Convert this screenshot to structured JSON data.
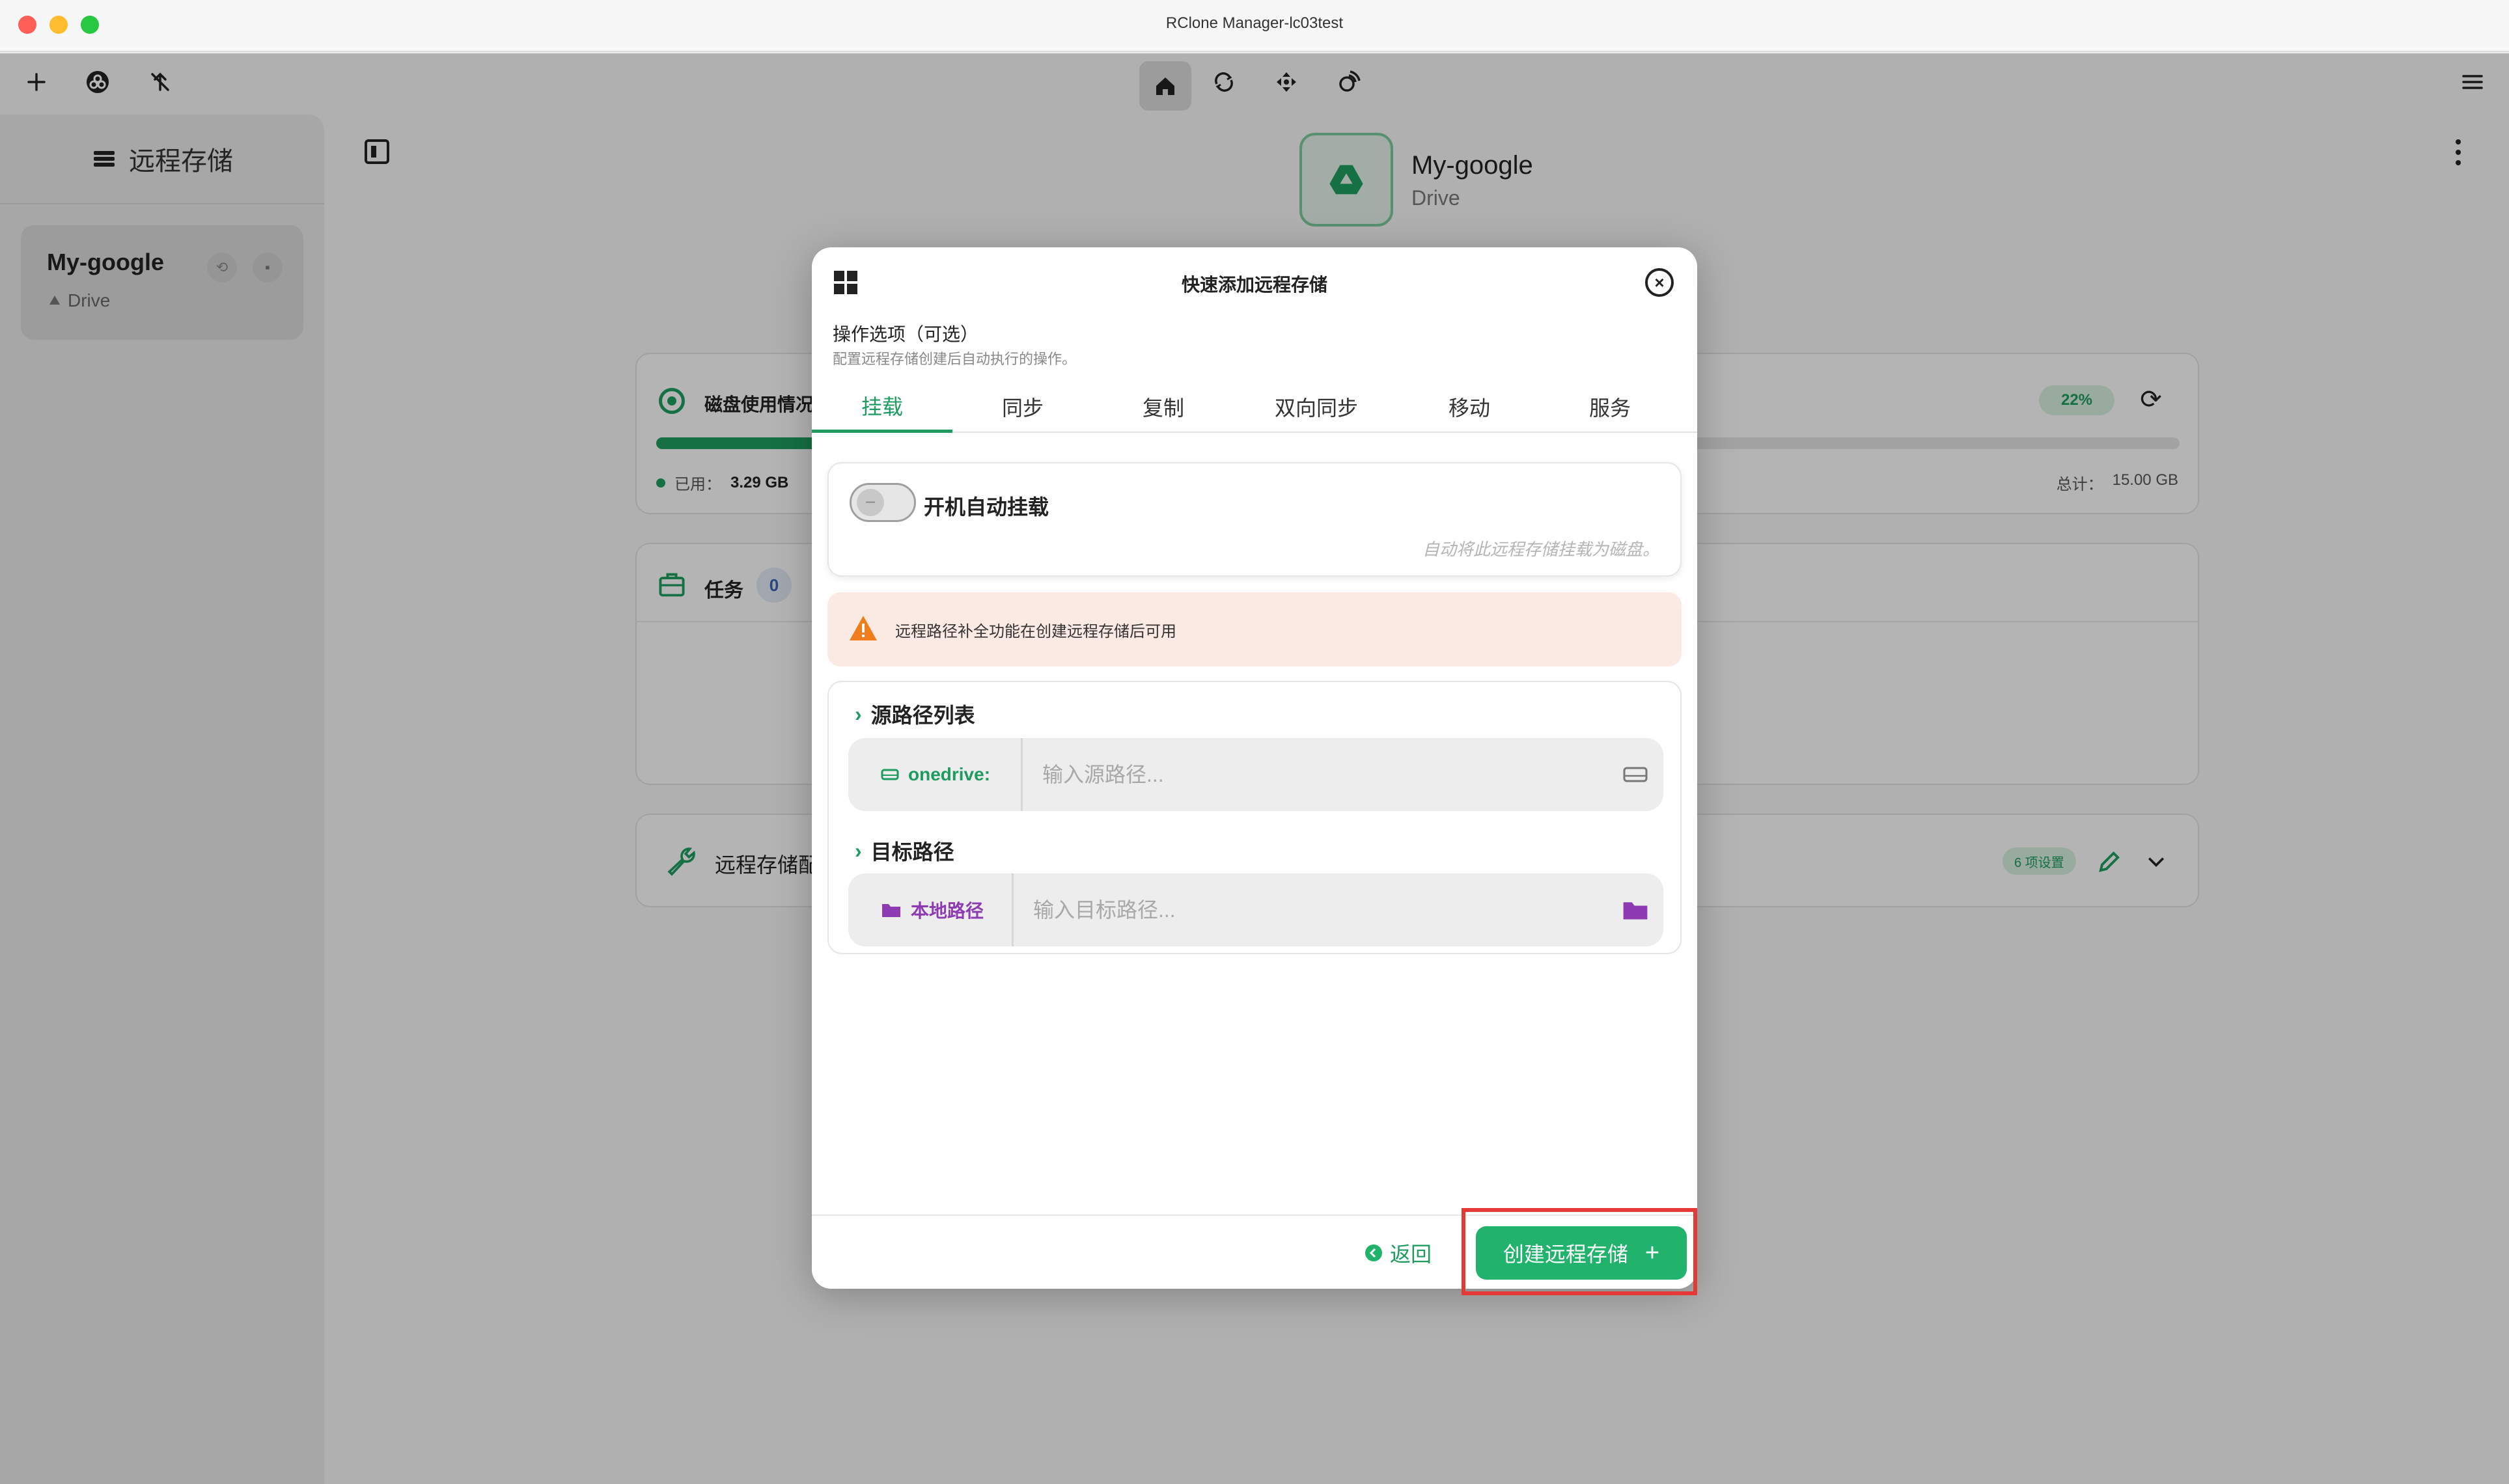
{
  "window": {
    "title": "RClone Manager-lc03test"
  },
  "toolbar": {
    "left_icons": [
      "plus-icon",
      "rclone-logo-icon",
      "no-network-icon"
    ],
    "center_icons": [
      "home-icon",
      "sync-icon",
      "move-icon",
      "serve-icon"
    ],
    "right_icon": "menu-icon"
  },
  "sidebar": {
    "title": "远程存储",
    "remotes": [
      {
        "name": "My-google",
        "type": "Drive"
      }
    ]
  },
  "main": {
    "remote_name": "My-google",
    "remote_type": "Drive",
    "disk": {
      "title": "磁盘使用情况",
      "used_label": "已用：",
      "used": "3.29 GB",
      "total_label": "总计：",
      "total": "15.00 GB",
      "percent_text": "22%",
      "percent": 0.22
    },
    "tasks": {
      "title": "任务",
      "count": "0"
    },
    "config": {
      "title": "远程存储配",
      "badge": "6 项设置"
    }
  },
  "modal": {
    "title": "快速添加远程存储",
    "options_title": "操作选项（可选）",
    "options_subtitle": "配置远程存储创建后自动执行的操作。",
    "tabs": [
      "挂载",
      "同步",
      "复制",
      "双向同步",
      "移动",
      "服务"
    ],
    "active_tab": 0,
    "mount": {
      "toggle_label": "开机自动挂载",
      "hint": "自动将此远程存储挂载为磁盘。",
      "enabled": false
    },
    "warning": "远程路径补全功能在创建远程存储后可用",
    "source": {
      "section_label": "源路径列表",
      "prefix": "onedrive:",
      "placeholder": "输入源路径..."
    },
    "target": {
      "section_label": "目标路径",
      "prefix": "本地路径",
      "placeholder": "输入目标路径..."
    },
    "footer": {
      "back_label": "返回",
      "create_label": "创建远程存储",
      "create_icon": "+"
    }
  },
  "colors": {
    "accent": "#1e9b5f",
    "button": "#21b26b",
    "warning_bg": "#fbeae3",
    "warning_icon": "#f07c1c",
    "local_path": "#8e3bb3",
    "highlight": "#e53935"
  }
}
